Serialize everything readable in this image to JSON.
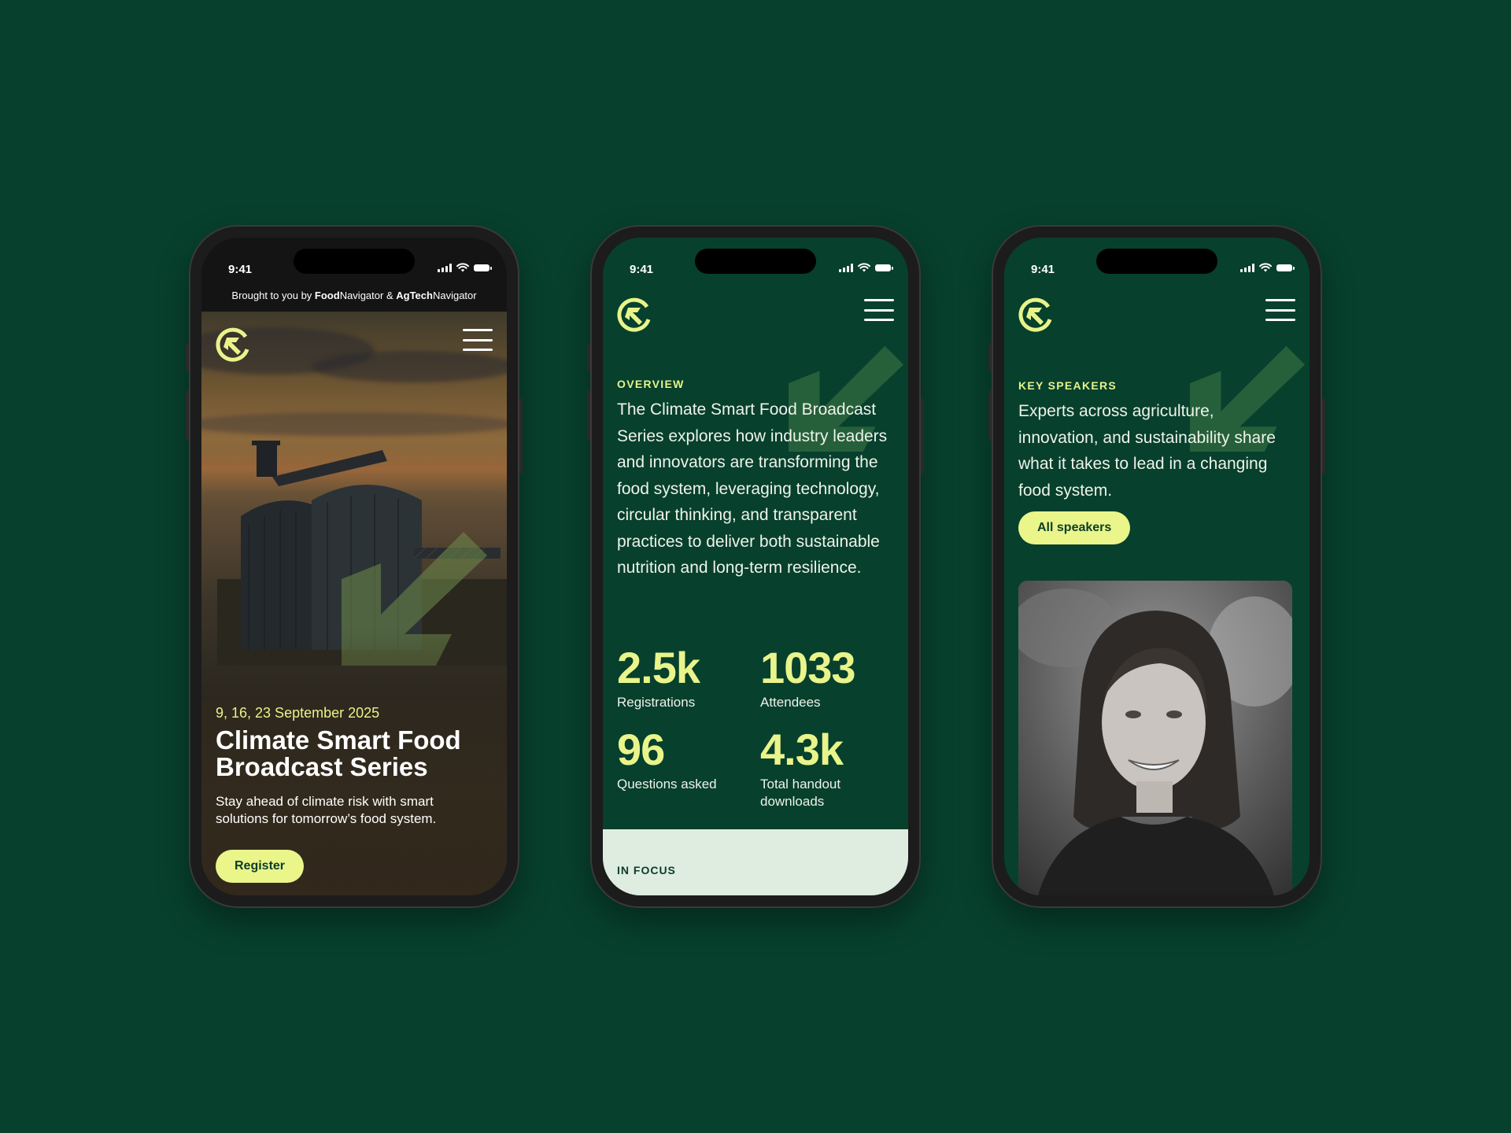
{
  "status_bar": {
    "time": "9:41"
  },
  "phone1": {
    "sponsor_prefix": "Brought to you by ",
    "sponsor_a_bold": "Food",
    "sponsor_a_rest": "Navigator",
    "sponsor_sep": " & ",
    "sponsor_b_bold": "AgTech",
    "sponsor_b_rest": "Navigator",
    "date": "9, 16, 23 September 2025",
    "title": "Climate Smart Food Broadcast Series",
    "subtitle": "Stay ahead of climate risk with smart solutions for tomorrow’s food system.",
    "cta": "Register"
  },
  "phone2": {
    "section_label": "OVERVIEW",
    "body": "The Climate Smart Food Broadcast Series explores how industry leaders and innovators are transforming the food system, leveraging technology, circular thinking, and transparent practices to deliver both sustainable nutrition and long-term resilience.",
    "stats": [
      {
        "value": "2.5k",
        "label": "Registrations"
      },
      {
        "value": "1033",
        "label": "Attendees"
      },
      {
        "value": "96",
        "label": "Questions asked"
      },
      {
        "value": "4.3k",
        "label": "Total handout downloads"
      }
    ],
    "next_section_label": "IN FOCUS"
  },
  "phone3": {
    "section_label": "KEY SPEAKERS",
    "body": "Experts across agriculture, innovation, and sustainability share what it takes to lead in a changing food system.",
    "cta": "All speakers"
  },
  "colors": {
    "background": "#07402d",
    "accent": "#eaf58a",
    "text": "#eef3ea"
  },
  "icons": [
    "logo-icon",
    "menu-icon",
    "signal-icon",
    "wifi-icon",
    "battery-icon",
    "arrow-graphic-icon"
  ]
}
